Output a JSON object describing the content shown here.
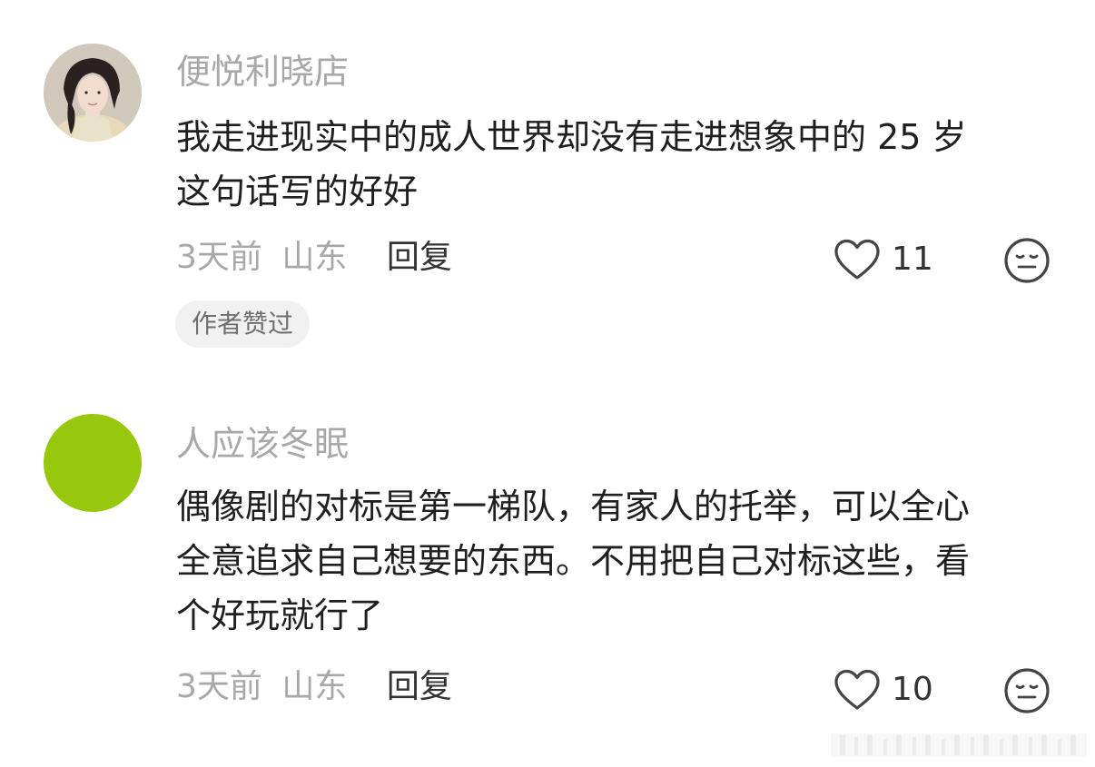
{
  "comments": [
    {
      "username": "便悦利晓店",
      "avatar_icon": "user-photo-avatar",
      "lines": [
        "我走进现实中的成人世界却没有走进想象中的 25 岁",
        "这句话写的好好"
      ],
      "time": "3天前",
      "location": "山东",
      "reply_label": "回复",
      "like_count": "11",
      "badge": "作者赞过"
    },
    {
      "username": "人应该冬眠",
      "avatar_color": "#97c80d",
      "lines": [
        "偶像剧的对标是第一梯队，有家人的托举，可以全心",
        "全意追求自己想要的东西。不用把自己对标这些，看",
        "个好玩就行了"
      ],
      "time": "3天前",
      "location": "山东",
      "reply_label": "回复",
      "like_count": "10"
    }
  ],
  "icons": {
    "like": "heart-outline-icon",
    "dislike": "meh-face-icon"
  },
  "colors": {
    "username": "#a8a8a8",
    "text": "#1f1f1f",
    "badge_bg": "#f1f1f1",
    "avatar_green": "#97c80d"
  }
}
